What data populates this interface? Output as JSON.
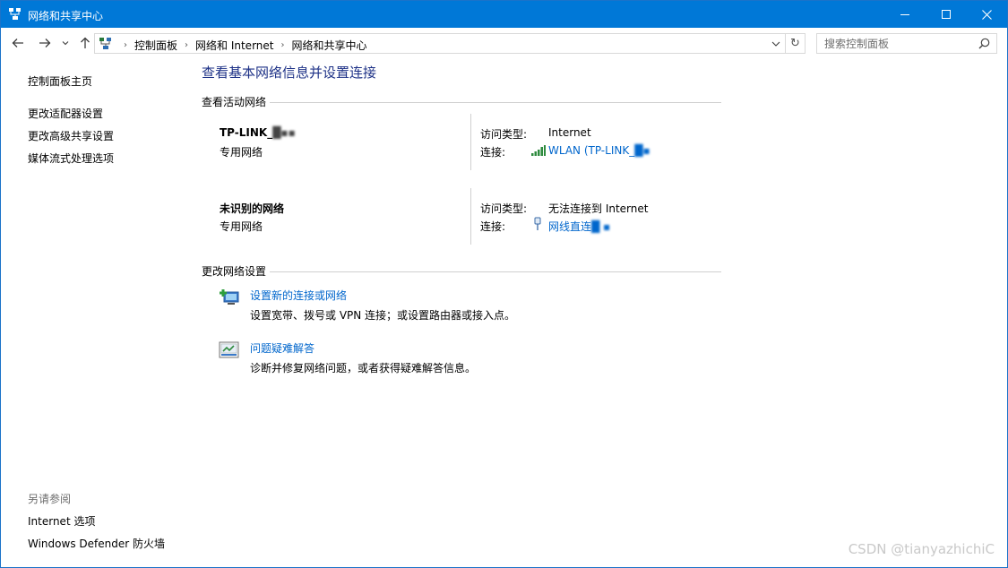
{
  "window": {
    "title": "网络和共享中心",
    "controls": {
      "minimize": "—",
      "maximize": "☐",
      "close": "✕"
    }
  },
  "address_bar": {
    "crumbs": [
      "控制面板",
      "网络和 Internet",
      "网络和共享中心"
    ],
    "search_placeholder": "搜索控制面板"
  },
  "left_pane": {
    "home": "控制面板主页",
    "links": [
      "更改适配器设置",
      "更改高级共享设置",
      "媒体流式处理选项"
    ],
    "see_also_label": "另请参阅",
    "see_also_links": [
      "Internet 选项",
      "Windows Defender 防火墙"
    ]
  },
  "main": {
    "title": "查看基本网络信息并设置连接",
    "active_networks_header": "查看活动网络",
    "networks": [
      {
        "name": "TP-LINK_",
        "type": "专用网络",
        "access_label": "访问类型:",
        "access_value": "Internet",
        "conn_label": "连接:",
        "conn_value": "WLAN (TP-LINK_"
      },
      {
        "name": "未识别的网络",
        "type": "专用网络",
        "access_label": "访问类型:",
        "access_value": "无法连接到 Internet",
        "conn_label": "连接:",
        "conn_value": "网线直连"
      }
    ],
    "change_settings_header": "更改网络设置",
    "tasks": [
      {
        "link": "设置新的连接或网络",
        "desc": "设置宽带、拨号或 VPN 连接；或设置路由器或接入点。"
      },
      {
        "link": "问题疑难解答",
        "desc": "诊断并修复网络问题，或者获得疑难解答信息。"
      }
    ]
  },
  "watermark": "CSDN @tianyazhichiC",
  "colors": {
    "titlebar": "#0078d7",
    "link": "#0066cc",
    "heading": "#1e3287"
  }
}
